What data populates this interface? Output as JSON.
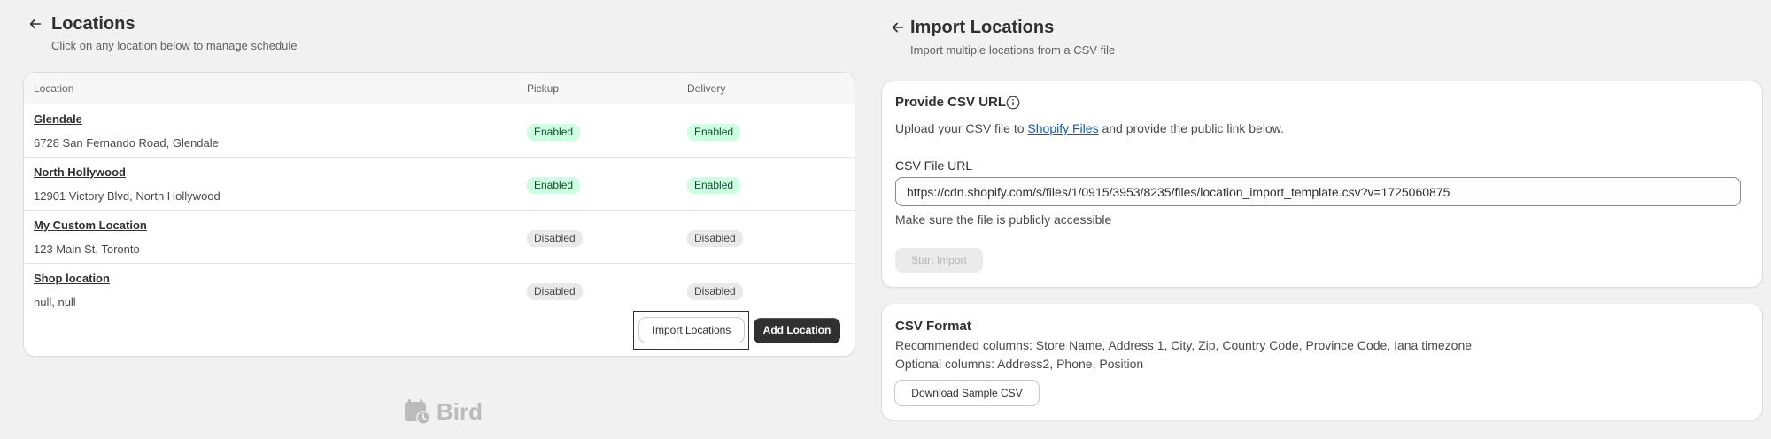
{
  "locations_page": {
    "title": "Locations",
    "subtitle": "Click on any location below to manage schedule",
    "table": {
      "headers": [
        "Location",
        "Pickup",
        "Delivery"
      ],
      "rows": [
        {
          "name": "Glendale",
          "address": "6728 San Fernando Road, Glendale",
          "pickup": "Enabled",
          "delivery": "Enabled"
        },
        {
          "name": "North Hollywood",
          "address": "12901 Victory Blvd, North Hollywood",
          "pickup": "Enabled",
          "delivery": "Enabled"
        },
        {
          "name": "My Custom Location",
          "address": "123 Main St, Toronto",
          "pickup": "Disabled",
          "delivery": "Disabled"
        },
        {
          "name": "Shop location",
          "address": "null, null",
          "pickup": "Disabled",
          "delivery": "Disabled"
        }
      ]
    },
    "import_button": "Import Locations",
    "add_button": "Add Location",
    "brand": "Bird"
  },
  "import_page": {
    "title": "Import Locations",
    "subtitle": "Import multiple locations from a CSV file",
    "csv_url_card": {
      "title": "Provide CSV URL",
      "description_prefix": "Upload your CSV file to",
      "description_link": "Shopify Files",
      "description_suffix": "and provide the public link below.",
      "field_label": "CSV File URL",
      "field_value": "https://cdn.shopify.com/s/files/1/0915/3953/8235/files/location_import_template.csv?v=1725060875",
      "help_text": "Make sure the file is publicly accessible",
      "start_button": "Start Import"
    },
    "csv_format_card": {
      "title": "CSV Format",
      "recommended": "Recommended columns: Store Name, Address 1, City, Zip, Country Code, Province Code, Iana timezone",
      "optional": "Optional columns: Address2, Phone, Position",
      "download_button": "Download Sample CSV"
    }
  },
  "colors": {
    "enabled_bg": "#cdfee1",
    "enabled_text": "#0c5132",
    "disabled_bg": "#e9e9e9",
    "primary_button": "#303030",
    "link": "#005bd3"
  }
}
